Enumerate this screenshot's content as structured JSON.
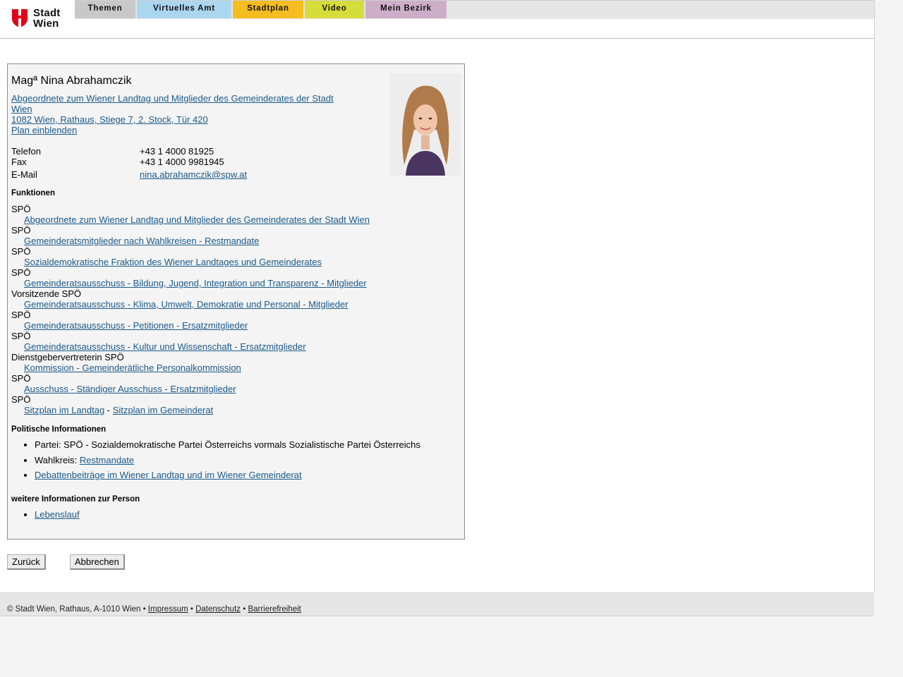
{
  "header": {
    "logo_text_1": "Stadt",
    "logo_text_2": "Wien",
    "nav": [
      {
        "label": "Themen",
        "color": "#c8c8c8"
      },
      {
        "label": "Virtuelles Amt",
        "color": "#abd6f0"
      },
      {
        "label": "Stadtplan",
        "color": "#f5bd1f"
      },
      {
        "label": "Video",
        "color": "#d6dc3a"
      },
      {
        "label": "Mein Bezirk",
        "color": "#cdaec8"
      }
    ]
  },
  "person": {
    "name": "Magª Nina Abrahamczik",
    "role_line_1": "Abgeordnete zum Wiener Landtag und Mitglieder des Gemeinderates der Stadt",
    "role_line_2": "Wien ",
    "address": "1082 Wien, Rathaus, Stiege 7, 2. Stock, Tür 420",
    "plan_link": "Plan einblenden",
    "contact": {
      "phone_label": "Telefon",
      "phone": "+43 1 4000 81925",
      "fax_label": "Fax",
      "fax": "+43 1 4000 9981945",
      "email_label": "E-Mail",
      "email": "nina.abrahamczik@spw.at"
    }
  },
  "funktionen": {
    "heading": "Funktionen",
    "items": [
      {
        "role": "SPÖ",
        "link": "Abgeordnete zum Wiener Landtag und Mitglieder des Gemeinderates der Stadt Wien"
      },
      {
        "role": "SPÖ",
        "link": "Gemeinderatsmitglieder nach Wahlkreisen - Restmandate"
      },
      {
        "role": "SPÖ",
        "link": "Sozialdemokratische Fraktion des Wiener Landtages und Gemeinderates"
      },
      {
        "role": "SPÖ",
        "link": "Gemeinderatsausschuss - Bildung, Jugend, Integration und Transparenz - Mitglieder"
      },
      {
        "role": "Vorsitzende SPÖ",
        "link": "Gemeinderatsausschuss - Klima, Umwelt, Demokratie und Personal - Mitglieder"
      },
      {
        "role": "SPÖ",
        "link": "Gemeinderatsausschuss - Petitionen - Ersatzmitglieder"
      },
      {
        "role": "SPÖ",
        "link": "Gemeinderatsausschuss - Kultur und Wissenschaft - Ersatzmitglieder"
      },
      {
        "role": "Dienstgebervertreterin SPÖ",
        "link": "Kommission - Gemeinderätliche Personalkommission"
      },
      {
        "role": "SPÖ",
        "link": "Ausschuss - Ständiger Ausschuss - Ersatzmitglieder"
      }
    ],
    "last_role": "SPÖ",
    "sitzplan_landtag": "Sitzplan im Landtag",
    "sitzplan_sep": " - ",
    "sitzplan_gemeinderat": "Sitzplan im Gemeinderat"
  },
  "politisch": {
    "heading": "Politische Informationen",
    "partei": "Partei: SPÖ - Sozialdemokratische Partei Österreichs vormals Sozialistische Partei Österreichs",
    "wahlkreis_label": "Wahlkreis: ",
    "wahlkreis_link": "Restmandate",
    "debatten": "Debattenbeiträge im Wiener Landtag und im Wiener Gemeinderat"
  },
  "weitere": {
    "heading": "weitere Informationen zur Person",
    "lebenslauf": "Lebenslauf"
  },
  "buttons": {
    "back": "Zurück",
    "cancel": "Abbrechen"
  },
  "footer": {
    "copyright": "© Stadt Wien, Rathaus, A-1010 Wien",
    "sep": " • ",
    "impressum": "Impressum",
    "datenschutz": "Datenschutz",
    "barrierefreiheit": "Barrierefreiheit"
  }
}
